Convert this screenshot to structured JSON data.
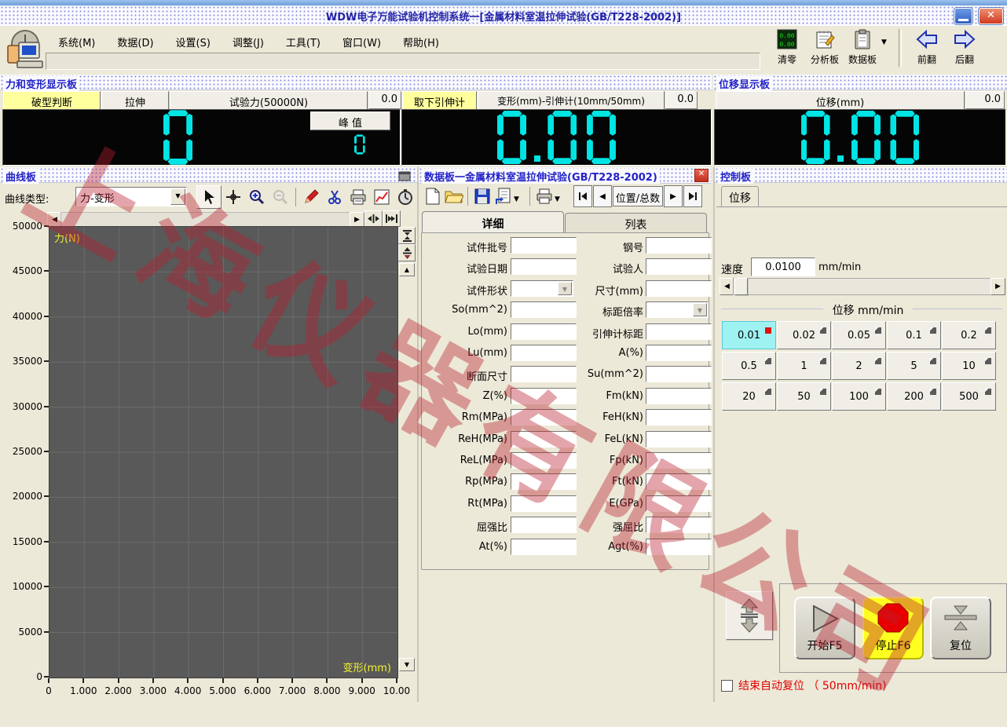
{
  "window": {
    "title": "WDW电子万能试验机控制系统一[金属材料室温拉伸试验(GB/T228-2002)]"
  },
  "menu": {
    "items": [
      "系统(M)",
      "数据(D)",
      "设置(S)",
      "调整(J)",
      "工具(T)",
      "窗口(W)",
      "帮助(H)"
    ]
  },
  "toolbar": {
    "buttons": [
      {
        "label": "清零",
        "icon": "zero-display-icon"
      },
      {
        "label": "分析板",
        "icon": "analysis-pad-icon"
      },
      {
        "label": "数据板",
        "icon": "clipboard-icon"
      }
    ],
    "nav": [
      {
        "label": "前翻",
        "icon": "page-prev-icon"
      },
      {
        "label": "后翻",
        "icon": "page-next-icon"
      }
    ]
  },
  "force_panel": {
    "title": "力和变形显示板",
    "break_btn": "破型判断",
    "mode_btn": "拉伸",
    "force_label": "试验力(50000N)",
    "force_value_small": "0.0",
    "force_display": "0",
    "peak_btn": "峰 值",
    "peak_display": "0",
    "ext_btn": "取下引伸计",
    "deform_label": "变形(mm)-引伸计(10mm/50mm)",
    "deform_value_small": "0.0",
    "deform_display": "0.00"
  },
  "disp_panel": {
    "title": "位移显示板",
    "label": "位移(mm)",
    "value_small": "0.0",
    "display": "0.00"
  },
  "curve_panel": {
    "title": "曲线板",
    "type_label": "曲线类型:",
    "type_value": "力-变形"
  },
  "chart_data": {
    "type": "line",
    "title": "力-变形",
    "xlabel": "变形(mm)",
    "ylabel": "力(N)",
    "xlim": [
      0,
      10
    ],
    "ylim": [
      0,
      50000
    ],
    "x_ticks": [
      "0",
      "1.000",
      "2.000",
      "3.000",
      "4.000",
      "5.000",
      "6.000",
      "7.000",
      "8.000",
      "9.000",
      "10.00"
    ],
    "y_ticks": [
      "50000",
      "45000",
      "40000",
      "35000",
      "30000",
      "25000",
      "20000",
      "15000",
      "10000",
      "5000",
      "0"
    ],
    "grid": true,
    "plot_bg": "#595959",
    "series": []
  },
  "data_panel": {
    "title": "数据板一金属材料室温拉伸试验(GB/T228-2002)",
    "nav_label": "位置/总数",
    "tabs": [
      "详细",
      "列表"
    ],
    "fields": [
      {
        "l": "试件批号",
        "lt": "input",
        "r": "钢号",
        "rt": "input"
      },
      {
        "l": "试验日期",
        "lt": "input",
        "r": "试验人",
        "rt": "input"
      },
      {
        "l": "试件形状",
        "lt": "select",
        "r": "尺寸(mm)",
        "rt": "input"
      },
      {
        "l": "So(mm^2)",
        "lt": "input",
        "r": "标距倍率",
        "rt": "select"
      },
      {
        "l": "Lo(mm)",
        "lt": "input",
        "r": "引伸计标距",
        "rt": "input"
      },
      {
        "l": "Lu(mm)",
        "lt": "input",
        "r": "A(%)",
        "rt": "input"
      },
      {
        "l": "断面尺寸",
        "lt": "input",
        "r": "Su(mm^2)",
        "rt": "input"
      },
      {
        "l": "Z(%)",
        "lt": "input",
        "r": "Fm(kN)",
        "rt": "input"
      },
      {
        "l": "Rm(MPa)",
        "lt": "input",
        "r": "FeH(kN)",
        "rt": "input"
      },
      {
        "l": "ReH(MPa)",
        "lt": "input",
        "r": "FeL(kN)",
        "rt": "input"
      },
      {
        "l": "ReL(MPa)",
        "lt": "input",
        "r": "Fp(kN)",
        "rt": "input"
      },
      {
        "l": "Rp(MPa)",
        "lt": "input",
        "r": "Ft(kN)",
        "rt": "input"
      },
      {
        "l": "Rt(MPa)",
        "lt": "input",
        "r": "E(GPa)",
        "rt": "input"
      },
      {
        "l": "屈强比",
        "lt": "input",
        "r": "强屈比",
        "rt": "input"
      },
      {
        "l": "At(%)",
        "lt": "input",
        "r": "Agt(%)",
        "rt": "input"
      }
    ]
  },
  "control_panel": {
    "title": "控制板",
    "tab": "位移",
    "speed_label": "速度",
    "speed_value": "0.0100",
    "speed_unit": "mm/min",
    "group_label": "位移 mm/min",
    "speed_buttons": [
      {
        "label": "0.01",
        "selected": true
      },
      {
        "label": "0.02",
        "selected": false
      },
      {
        "label": "0.05",
        "selected": false
      },
      {
        "label": "0.1",
        "selected": false
      },
      {
        "label": "0.2",
        "selected": false
      },
      {
        "label": "0.5",
        "selected": false
      },
      {
        "label": "1",
        "selected": false
      },
      {
        "label": "2",
        "selected": false
      },
      {
        "label": "5",
        "selected": false
      },
      {
        "label": "10",
        "selected": false
      },
      {
        "label": "20",
        "selected": false
      },
      {
        "label": "50",
        "selected": false
      },
      {
        "label": "100",
        "selected": false
      },
      {
        "label": "200",
        "selected": false
      },
      {
        "label": "500",
        "selected": false
      }
    ],
    "start_btn": "开始F5",
    "stop_btn": "停止F6",
    "reset_btn": "复位",
    "auto_reset_checkbox": "结束自动复位 （ 50mm/min)"
  },
  "watermark": "上海仪器有限公司"
}
